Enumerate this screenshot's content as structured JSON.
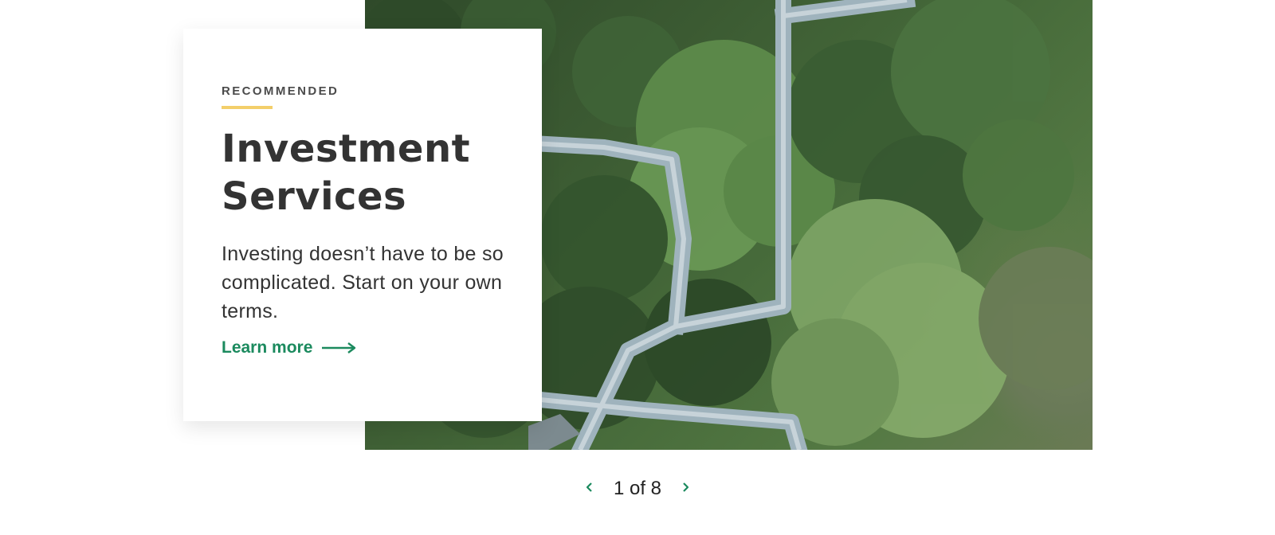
{
  "card": {
    "eyebrow": "RECOMMENDED",
    "title_line1": "Investment",
    "title_line2": "Services",
    "description": "Investing doesn’t have to be so complicated. Start on your own terms.",
    "link_label": "Learn more"
  },
  "pager": {
    "text": "1 of 8",
    "prev_icon": "chevron-left-icon",
    "next_icon": "chevron-right-icon"
  },
  "colors": {
    "accent_rule": "#f3cf6a",
    "link_green": "#1b8a5e",
    "title_text": "#333333"
  },
  "image": {
    "subject": "aerial-forest-canopy-walkway-photo"
  }
}
